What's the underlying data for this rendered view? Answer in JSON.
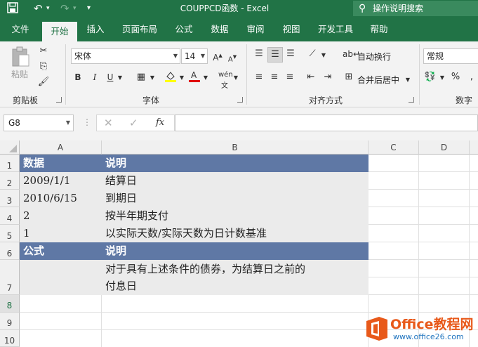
{
  "window": {
    "title": "COUPPCD函数  -  Excel",
    "tell_me": "操作说明搜索"
  },
  "ribbon": {
    "tabs": [
      "文件",
      "开始",
      "插入",
      "页面布局",
      "公式",
      "数据",
      "审阅",
      "视图",
      "开发工具",
      "帮助"
    ],
    "active_tab": "开始",
    "clipboard": {
      "paste_label": "粘贴",
      "group_label": "剪贴板"
    },
    "font": {
      "font_name": "宋体",
      "font_size": "14",
      "group_label": "字体",
      "bold": "B",
      "italic": "I",
      "underline": "U"
    },
    "alignment": {
      "wrap_text": "自动换行",
      "merge_center": "合并后居中",
      "group_label": "对齐方式"
    },
    "number": {
      "format": "常规",
      "group_label": "数字",
      "percent": "%"
    }
  },
  "formula_bar": {
    "name_box": "G8",
    "fx": "fx",
    "content": ""
  },
  "sheet": {
    "columns": [
      "A",
      "B",
      "C",
      "D"
    ],
    "rows": [
      "1",
      "2",
      "3",
      "4",
      "5",
      "6",
      "7",
      "8",
      "9",
      "10"
    ],
    "cells": {
      "A1": "数据",
      "B1": "说明",
      "A2": "2009/1/1",
      "B2": "结算日",
      "A3": "2010/6/15",
      "B3": "到期日",
      "A4": "2",
      "B4": "按半年期支付",
      "A5": "1",
      "B5": "以实际天数/实际天数为日计数基准",
      "A6": "公式",
      "B6": "说明",
      "A7": "",
      "B7_line1": "对于具有上述条件的债券，为结算日之前的",
      "B7_line2": "付息日"
    }
  },
  "watermark": {
    "brand": "Office教程网",
    "url": "www.office26.com",
    "colors": {
      "orange": "#e8591a",
      "blue": "#1e73be"
    }
  },
  "colors": {
    "excel_green": "#217346",
    "header_fill": "#5f78a5",
    "data_fill": "#ebebeb"
  }
}
